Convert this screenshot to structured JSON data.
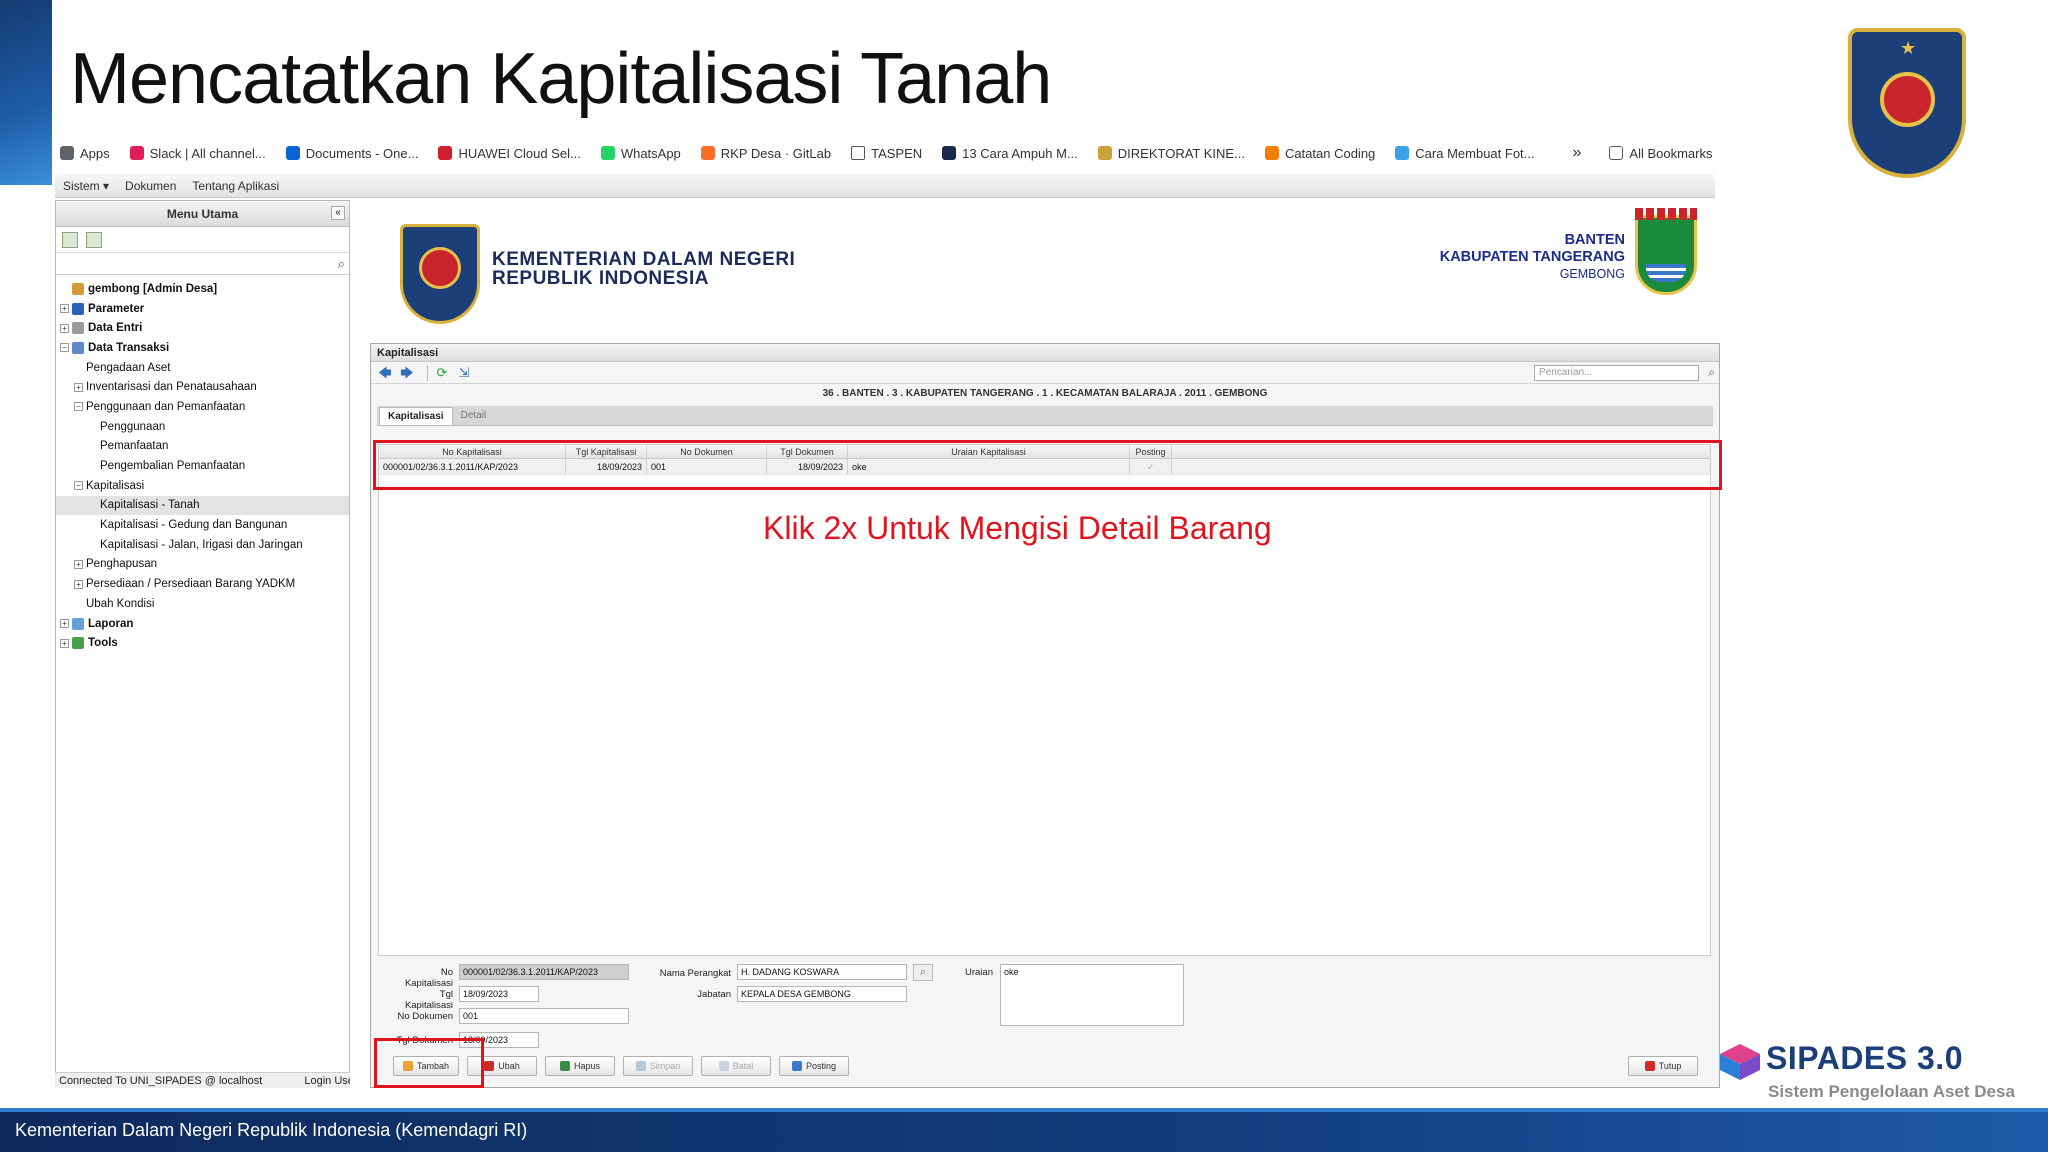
{
  "slide": {
    "title": "Mencatatkan Kapitalisasi Tanah",
    "instruction": "Klik 2x Untuk Mengisi Detail Barang",
    "footer": "Kementerian Dalam Negeri Republik Indonesia (Kemendagri RI)",
    "sipades_title": "SIPADES 3.0",
    "sipades_subtitle": "Sistem Pengelolaan Aset Desa"
  },
  "bookmarks": [
    {
      "label": "Apps",
      "icon": "apps-grid-icon",
      "color": "#5f6368"
    },
    {
      "label": "Slack | All channel...",
      "icon": "slack-icon",
      "color": "#e01e5a"
    },
    {
      "label": "Documents - One...",
      "icon": "onedrive-icon",
      "color": "#0a64d6"
    },
    {
      "label": "HUAWEI Cloud Sel...",
      "icon": "huawei-icon",
      "color": "#cf1f2e"
    },
    {
      "label": "WhatsApp",
      "icon": "whatsapp-icon",
      "color": "#25d366"
    },
    {
      "label": "RKP Desa · GitLab",
      "icon": "gitlab-icon",
      "color": "#fc6d26"
    },
    {
      "label": "TASPEN",
      "icon": "folder-icon",
      "color": "#ffffff"
    },
    {
      "label": "13 Cara Ampuh M...",
      "icon": "site-icon",
      "color": "#1a2b4a"
    },
    {
      "label": "DIREKTORAT KINE...",
      "icon": "garuda-icon",
      "color": "#c9a23a"
    },
    {
      "label": "Catatan Coding",
      "icon": "blogger-icon",
      "color": "#f57d00"
    },
    {
      "label": "Cara Membuat Fot...",
      "icon": "site-icon",
      "color": "#3aa0e8"
    }
  ],
  "bookmarks_more": "»",
  "bookmarks_all": "All Bookmarks",
  "menubar": [
    "Sistem ▾",
    "Dokumen",
    "Tentang Aplikasi"
  ],
  "sidebar": {
    "title": "Menu Utama",
    "collapse": "«",
    "tree": [
      {
        "label": "gembong [Admin Desa]",
        "level": 0,
        "bold": true,
        "toggle": "",
        "icon": "home-icon",
        "icolor": "#d49b3a"
      },
      {
        "label": "Parameter",
        "level": 0,
        "bold": true,
        "toggle": "+",
        "icon": "book-icon",
        "icolor": "#2a62b8"
      },
      {
        "label": "Data Entri",
        "level": 0,
        "bold": true,
        "toggle": "+",
        "icon": "mouse-icon",
        "icolor": "#9a9a9a"
      },
      {
        "label": "Data Transaksi",
        "level": 0,
        "bold": true,
        "toggle": "−",
        "icon": "transaction-icon",
        "icolor": "#5e88c8"
      },
      {
        "label": "Pengadaan Aset",
        "level": 1,
        "bold": false,
        "toggle": ""
      },
      {
        "label": "Inventarisasi dan Penatausahaan",
        "level": 1,
        "bold": false,
        "toggle": "+"
      },
      {
        "label": "Penggunaan dan Pemanfaatan",
        "level": 1,
        "bold": false,
        "toggle": "−"
      },
      {
        "label": "Penggunaan",
        "level": 2,
        "bold": false,
        "toggle": ""
      },
      {
        "label": "Pemanfaatan",
        "level": 2,
        "bold": false,
        "toggle": ""
      },
      {
        "label": "Pengembalian Pemanfaatan",
        "level": 2,
        "bold": false,
        "toggle": ""
      },
      {
        "label": "Kapitalisasi",
        "level": 1,
        "bold": false,
        "toggle": "−"
      },
      {
        "label": "Kapitalisasi - Tanah",
        "level": 2,
        "bold": false,
        "toggle": "",
        "selected": true
      },
      {
        "label": "Kapitalisasi - Gedung dan Bangunan",
        "level": 2,
        "bold": false,
        "toggle": ""
      },
      {
        "label": "Kapitalisasi - Jalan, Irigasi dan Jaringan",
        "level": 2,
        "bold": false,
        "toggle": ""
      },
      {
        "label": "Penghapusan",
        "level": 1,
        "bold": false,
        "toggle": "+"
      },
      {
        "label": "Persediaan / Persediaan Barang YADKM",
        "level": 1,
        "bold": false,
        "toggle": "+"
      },
      {
        "label": "Ubah Kondisi",
        "level": 1,
        "bold": false,
        "toggle": ""
      },
      {
        "label": "Laporan",
        "level": 0,
        "bold": true,
        "toggle": "+",
        "icon": "report-icon",
        "icolor": "#6aa0d8"
      },
      {
        "label": "Tools",
        "level": 0,
        "bold": true,
        "toggle": "+",
        "icon": "tools-icon",
        "icolor": "#4aa04a"
      }
    ]
  },
  "status": {
    "connected": "Connected To UNI_SIPADES @ localhost",
    "login": "Login User :"
  },
  "header": {
    "kemendagri_line1": "KEMENTERIAN DALAM NEGERI",
    "kemendagri_line2": "REPUBLIK INDONESIA",
    "province": "BANTEN",
    "regency": "KABUPATEN TANGERANG",
    "village": "GEMBONG"
  },
  "panel": {
    "title": "Kapitalisasi",
    "search_placeholder": "Pencarian...",
    "breadcrumb": "36 . BANTEN . 3 . KABUPATEN TANGERANG . 1 . KECAMATAN BALARAJA . 2011 . GEMBONG",
    "tabs": [
      "Kapitalisasi",
      "Detail"
    ]
  },
  "grid": {
    "columns": [
      "No Kapitalisasi",
      "Tgl Kapitalisasi",
      "No Dokumen",
      "Tgl Dokumen",
      "Uraian Kapitalisasi",
      "Posting"
    ],
    "rows": [
      [
        "000001/02/36.3.1.2011/KAP/2023",
        "18/09/2023",
        "001",
        "18/09/2023",
        "oke",
        "✓"
      ]
    ]
  },
  "form": {
    "no_kapitalisasi_label": "No Kapitalisasi",
    "no_kapitalisasi": "000001/02/36.3.1.2011/KAP/2023",
    "tgl_kapitalisasi_label": "Tgl Kapitalisasi",
    "tgl_kapitalisasi": "18/09/2023",
    "no_dokumen_label": "No Dokumen",
    "no_dokumen": "001",
    "tgl_dokumen_label": "Tgl Dokumen",
    "tgl_dokumen": "18/09/2023",
    "nama_perangkat_label": "Nama Perangkat",
    "nama_perangkat": "H. DADANG KOSWARA",
    "jabatan_label": "Jabatan",
    "jabatan": "KEPALA DESA GEMBONG",
    "uraian_label": "Uraian",
    "uraian": "oke"
  },
  "buttons": {
    "tambah": "Tambah",
    "ubah": "Ubah",
    "hapus": "Hapus",
    "simpan": "Simpan",
    "batal": "Batal",
    "posting": "Posting",
    "tutup": "Tutup"
  }
}
